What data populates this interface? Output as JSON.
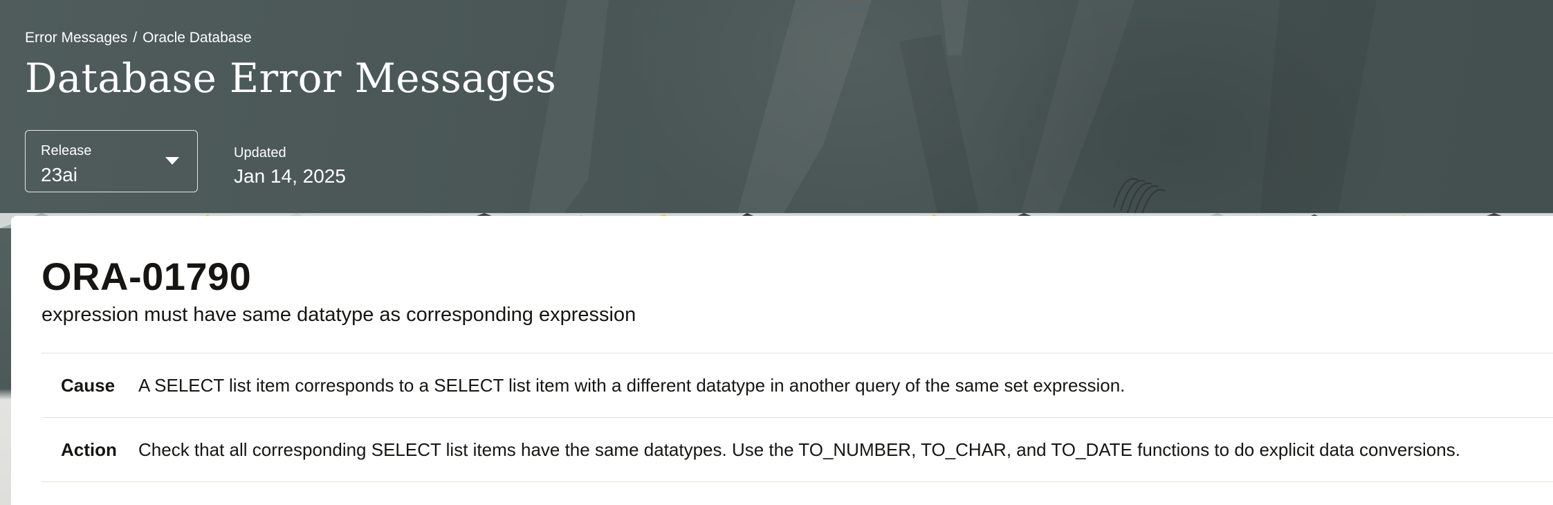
{
  "breadcrumb": {
    "items": [
      "Error Messages",
      "Oracle Database"
    ],
    "separator": "/"
  },
  "header": {
    "title": "Database Error Messages",
    "release": {
      "label": "Release",
      "value": "23ai"
    },
    "updated": {
      "label": "Updated",
      "value": "Jan 14, 2025"
    }
  },
  "error": {
    "code": "ORA-01790",
    "message": "expression must have same datatype as corresponding expression",
    "details": [
      {
        "key": "Cause",
        "text": "A SELECT list item corresponds to a SELECT list item with a different datatype in another query of the same set expression."
      },
      {
        "key": "Action",
        "text": "Check that all corresponding SELECT list items have the same datatypes. Use the TO_NUMBER, TO_CHAR, and TO_DATE functions to do explicit data conversions."
      }
    ]
  },
  "colors": {
    "hero_bg": "#4a5655",
    "text_dark": "#161513",
    "divider": "#e2e1dd",
    "accent_yellow": "#e6b93a"
  },
  "icons": {
    "release_caret": "chevron-down-icon"
  }
}
